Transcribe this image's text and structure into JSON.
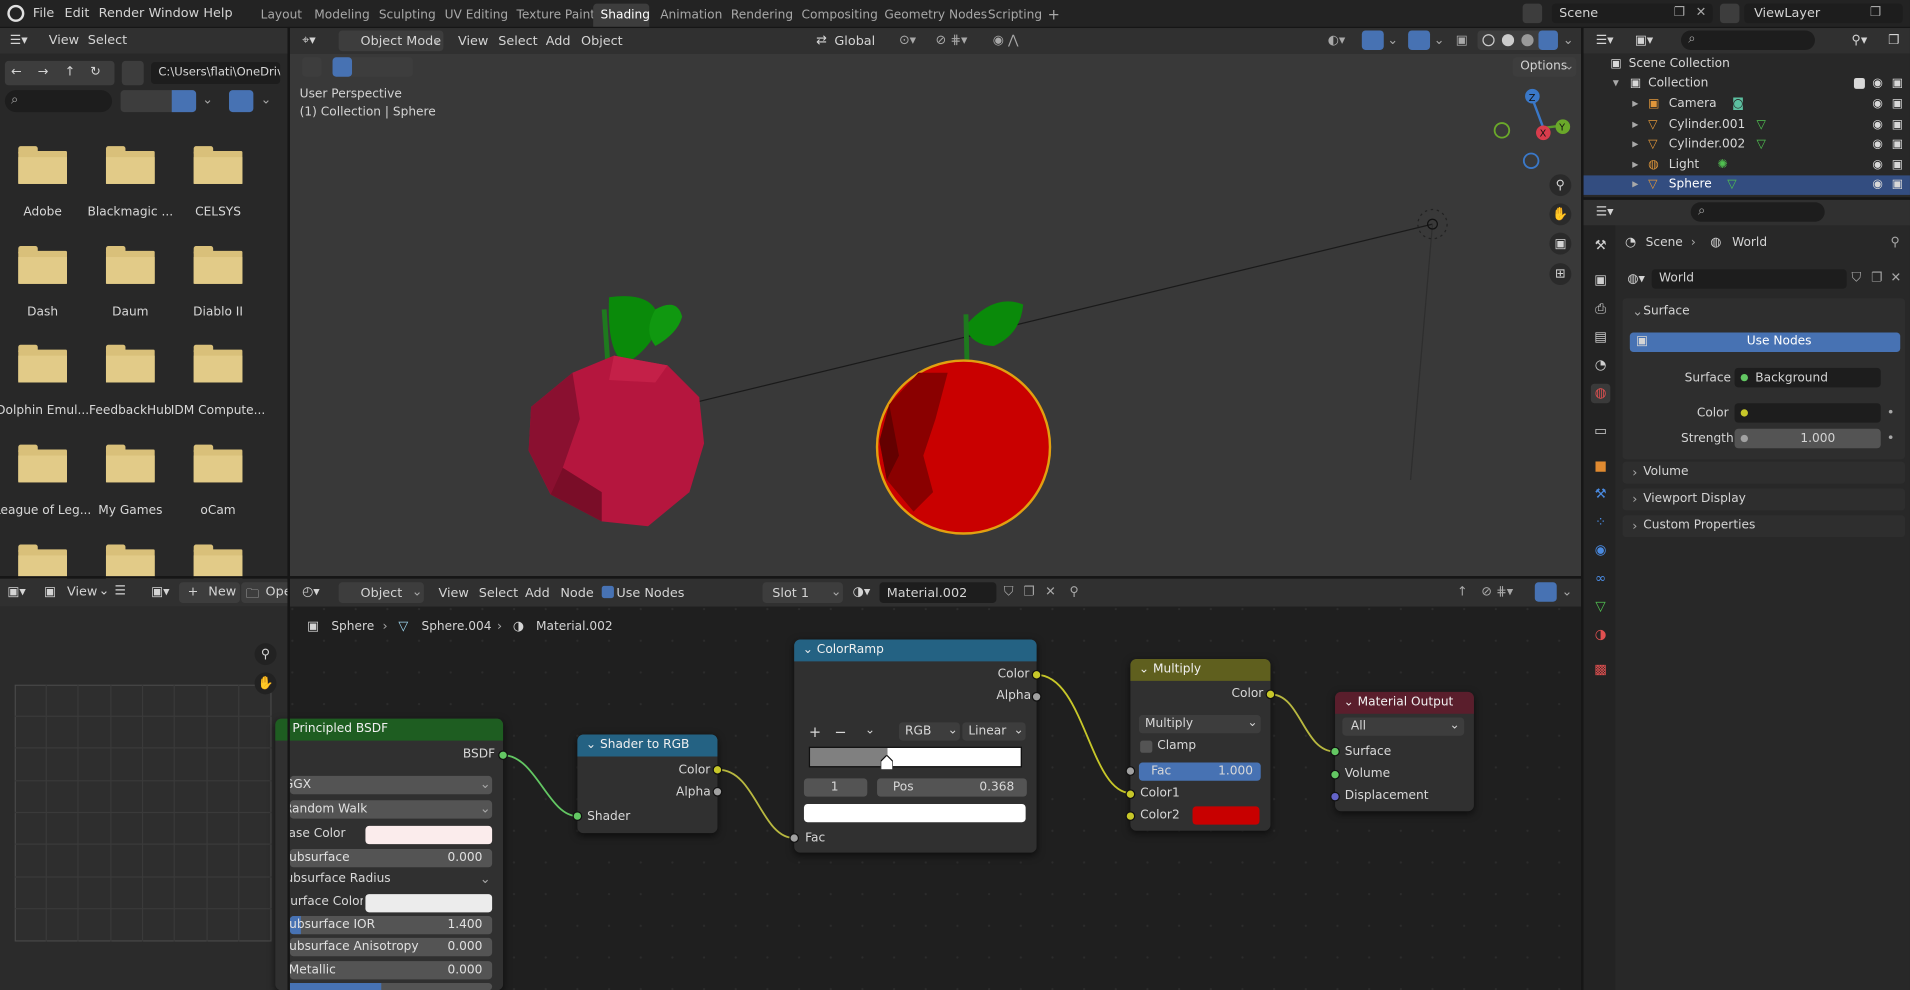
{
  "menu": {
    "file": "File",
    "edit": "Edit",
    "render": "Render",
    "window": "Window",
    "help": "Help"
  },
  "workspaces": [
    "Layout",
    "Modeling",
    "Sculpting",
    "UV Editing",
    "Texture Paint",
    "Shading",
    "Animation",
    "Rendering",
    "Compositing",
    "Geometry Nodes",
    "Scripting"
  ],
  "active_workspace": "Shading",
  "top_right": {
    "scene": "Scene",
    "view_layer": "ViewLayer"
  },
  "file_browser": {
    "view": "View",
    "select": "Select",
    "path": "C:\\Users\\flati\\OneDriv...",
    "folders": [
      "Adobe",
      "Blackmagic ...",
      "CELSYS",
      "Dash",
      "Daum",
      "Diablo II",
      "Dolphin Emul...",
      "FeedbackHub",
      "IDM Compute...",
      "League of Leg...",
      "My Games",
      "oCam"
    ]
  },
  "viewport": {
    "mode": "Object Mode",
    "view": "View",
    "select": "Select",
    "add": "Add",
    "object": "Object",
    "orientation": "Global",
    "options": "Options",
    "perspective": "User Perspective",
    "collection_label": "(1) Collection | Sphere",
    "gizmo": {
      "z": "Z",
      "x": "X",
      "y": "Y"
    }
  },
  "image_editor": {
    "view": "View",
    "new": "New",
    "open": "Open"
  },
  "node_editor": {
    "object": "Object",
    "view": "View",
    "select": "Select",
    "add": "Add",
    "node": "Node",
    "use_nodes": "Use Nodes",
    "slot": "Slot 1",
    "material": "Material.002",
    "breadcrumb": [
      "Sphere",
      "Sphere.004",
      "Material.002"
    ]
  },
  "nodes": {
    "bsdf": {
      "title": "Principled BSDF",
      "out": "BSDF",
      "dist": "GGX",
      "sss_method": "Random Walk",
      "rows": [
        {
          "label": "Base Color",
          "value": ""
        },
        {
          "label": "Subsurface",
          "value": "0.000"
        },
        {
          "label": "Subsurface Radius",
          "value": ""
        },
        {
          "label": "Subsurface Color",
          "value": ""
        },
        {
          "label": "Subsurface IOR",
          "value": "1.400"
        },
        {
          "label": "Subsurface Anisotropy",
          "value": "0.000"
        },
        {
          "label": "Metallic",
          "value": "0.000"
        }
      ]
    },
    "shader_to_rgb": {
      "title": "Shader to RGB",
      "color": "Color",
      "alpha": "Alpha",
      "shader": "Shader"
    },
    "color_ramp": {
      "title": "ColorRamp",
      "color": "Color",
      "alpha": "Alpha",
      "mode": "RGB",
      "interp": "Linear",
      "index": "1",
      "pos_label": "Pos",
      "pos": "0.368",
      "position": 0.368,
      "fac": "Fac"
    },
    "multiply": {
      "title": "Multiply",
      "color": "Color",
      "op": "Multiply",
      "clamp": "Clamp",
      "fac_label": "Fac",
      "fac": "1.000",
      "color1": "Color1",
      "color2": "Color2",
      "color2_hex": "#c80000"
    },
    "output": {
      "title": "Material Output",
      "target": "All",
      "surface": "Surface",
      "volume": "Volume",
      "displacement": "Displacement"
    }
  },
  "outliner": {
    "root": "Scene Collection",
    "collection": "Collection",
    "items": [
      {
        "name": "Camera",
        "selected": false
      },
      {
        "name": "Cylinder.001",
        "selected": false
      },
      {
        "name": "Cylinder.002",
        "selected": false
      },
      {
        "name": "Light",
        "selected": false
      },
      {
        "name": "Sphere",
        "selected": true
      }
    ]
  },
  "properties": {
    "breadcrumb": [
      "Scene",
      "World"
    ],
    "world_name": "World",
    "surface_panel": "Surface",
    "use_nodes": "Use Nodes",
    "surface_label": "Surface",
    "surface_value": "Background",
    "color_label": "Color",
    "strength_label": "Strength",
    "strength_value": "1.000",
    "sections": [
      "Volume",
      "Viewport Display",
      "Custom Properties"
    ]
  },
  "colors": {
    "accent": "#4772b3",
    "selected_row": "#334d80",
    "bsdf_header": "#1e5d21",
    "shader_header": "#246283",
    "multiply_header": "#5f5f1e",
    "output_header": "#5a1e2c",
    "socket_yellow": "#c7c729",
    "socket_green": "#63c763",
    "socket_grey": "#a1a1a1",
    "socket_purple": "#6363c7"
  }
}
